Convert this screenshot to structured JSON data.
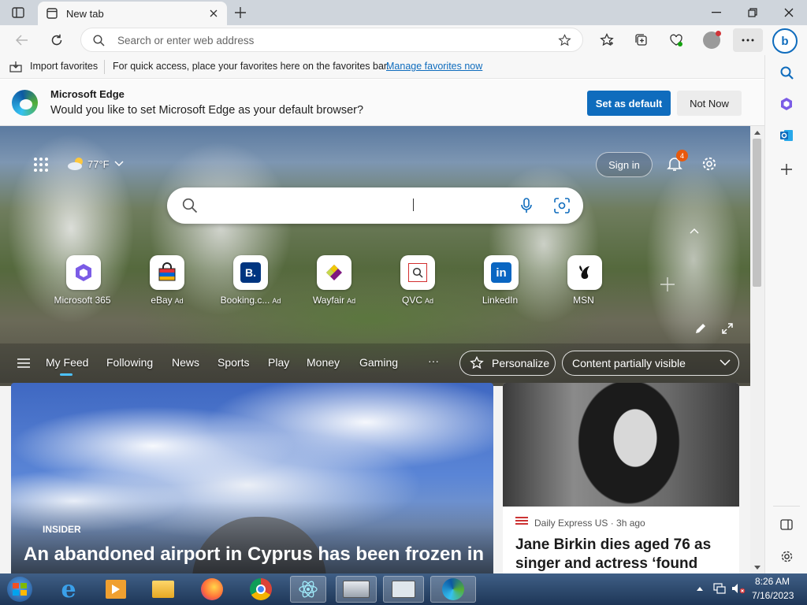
{
  "browser": {
    "tab_title": "New tab",
    "address_placeholder": "Search or enter web address"
  },
  "favorites_bar": {
    "import_label": "Import favorites",
    "message": "For quick access, place your favorites here on the favorites bar.",
    "manage_link": "Manage favorites now"
  },
  "infobar": {
    "title": "Microsoft Edge",
    "message": "Would you like to set Microsoft Edge as your default browser?",
    "set_default": "Set as default",
    "not_now": "Not Now"
  },
  "newtab": {
    "weather_temp": "77°F",
    "sign_in": "Sign in",
    "notification_count": "4",
    "quick_links": [
      {
        "label": "Microsoft 365",
        "ad": ""
      },
      {
        "label": "eBay",
        "ad": "Ad"
      },
      {
        "label": "Booking.c...",
        "ad": "Ad"
      },
      {
        "label": "Wayfair",
        "ad": "Ad"
      },
      {
        "label": "QVC",
        "ad": "Ad"
      },
      {
        "label": "LinkedIn",
        "ad": ""
      },
      {
        "label": "MSN",
        "ad": ""
      }
    ],
    "feed_tabs": [
      "My Feed",
      "Following",
      "News",
      "Sports",
      "Play",
      "Money",
      "Gaming"
    ],
    "more_label": "···",
    "personalize": "Personalize",
    "content_visibility": "Content partially visible"
  },
  "cards": {
    "main": {
      "tag": "INSIDER",
      "headline": "An abandoned airport in Cyprus has been frozen in"
    },
    "side": {
      "source": "Daily Express US · 3h ago",
      "headline": "Jane Birkin dies aged 76 as singer and actress ‘found"
    }
  },
  "taskbar": {
    "time": "8:26 AM",
    "date": "7/16/2023"
  },
  "colors": {
    "accent": "#0f6cbd",
    "tab_strip": "#cfd5dc",
    "taskbar": "#1e3657"
  }
}
